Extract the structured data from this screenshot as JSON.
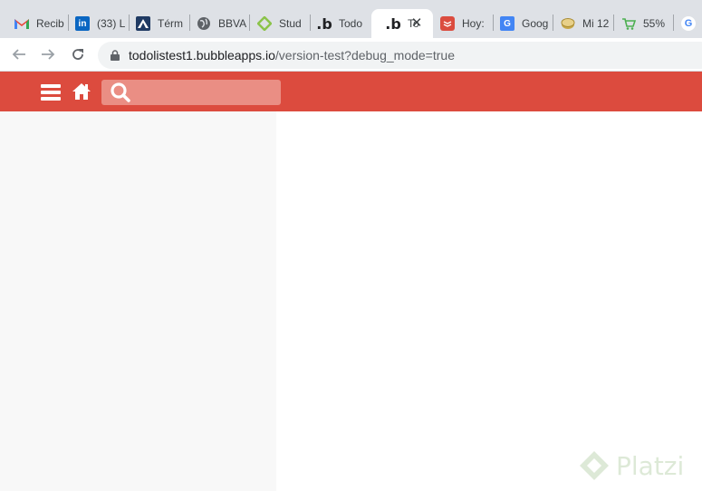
{
  "browser": {
    "tabs": [
      {
        "title": "Recib",
        "icon": "gmail-icon"
      },
      {
        "title": "(33) L",
        "icon": "linkedin-icon"
      },
      {
        "title": "Térm",
        "icon": "atlassian-icon"
      },
      {
        "title": "BBVA",
        "icon": "globe-icon"
      },
      {
        "title": "Stud",
        "icon": "studio-icon"
      },
      {
        "title": "Todo",
        "icon": "bubble-icon"
      },
      {
        "title": "To",
        "icon": "bubble-icon",
        "active": true
      },
      {
        "title": "Hoy:",
        "icon": "todoist-icon"
      },
      {
        "title": "Goog",
        "icon": "google-translate-icon"
      },
      {
        "title": "Mi 12",
        "icon": "coin-icon"
      },
      {
        "title": "55%",
        "icon": "cart-icon"
      },
      {
        "title": "",
        "icon": "google-icon"
      }
    ],
    "url": {
      "host": "todolistest1.bubbleapps.io",
      "path": "/version-test?debug_mode=true"
    }
  },
  "app": {
    "accent": "#dc4b3e",
    "search_placeholder": ""
  },
  "watermark": {
    "text": "Platzi"
  }
}
